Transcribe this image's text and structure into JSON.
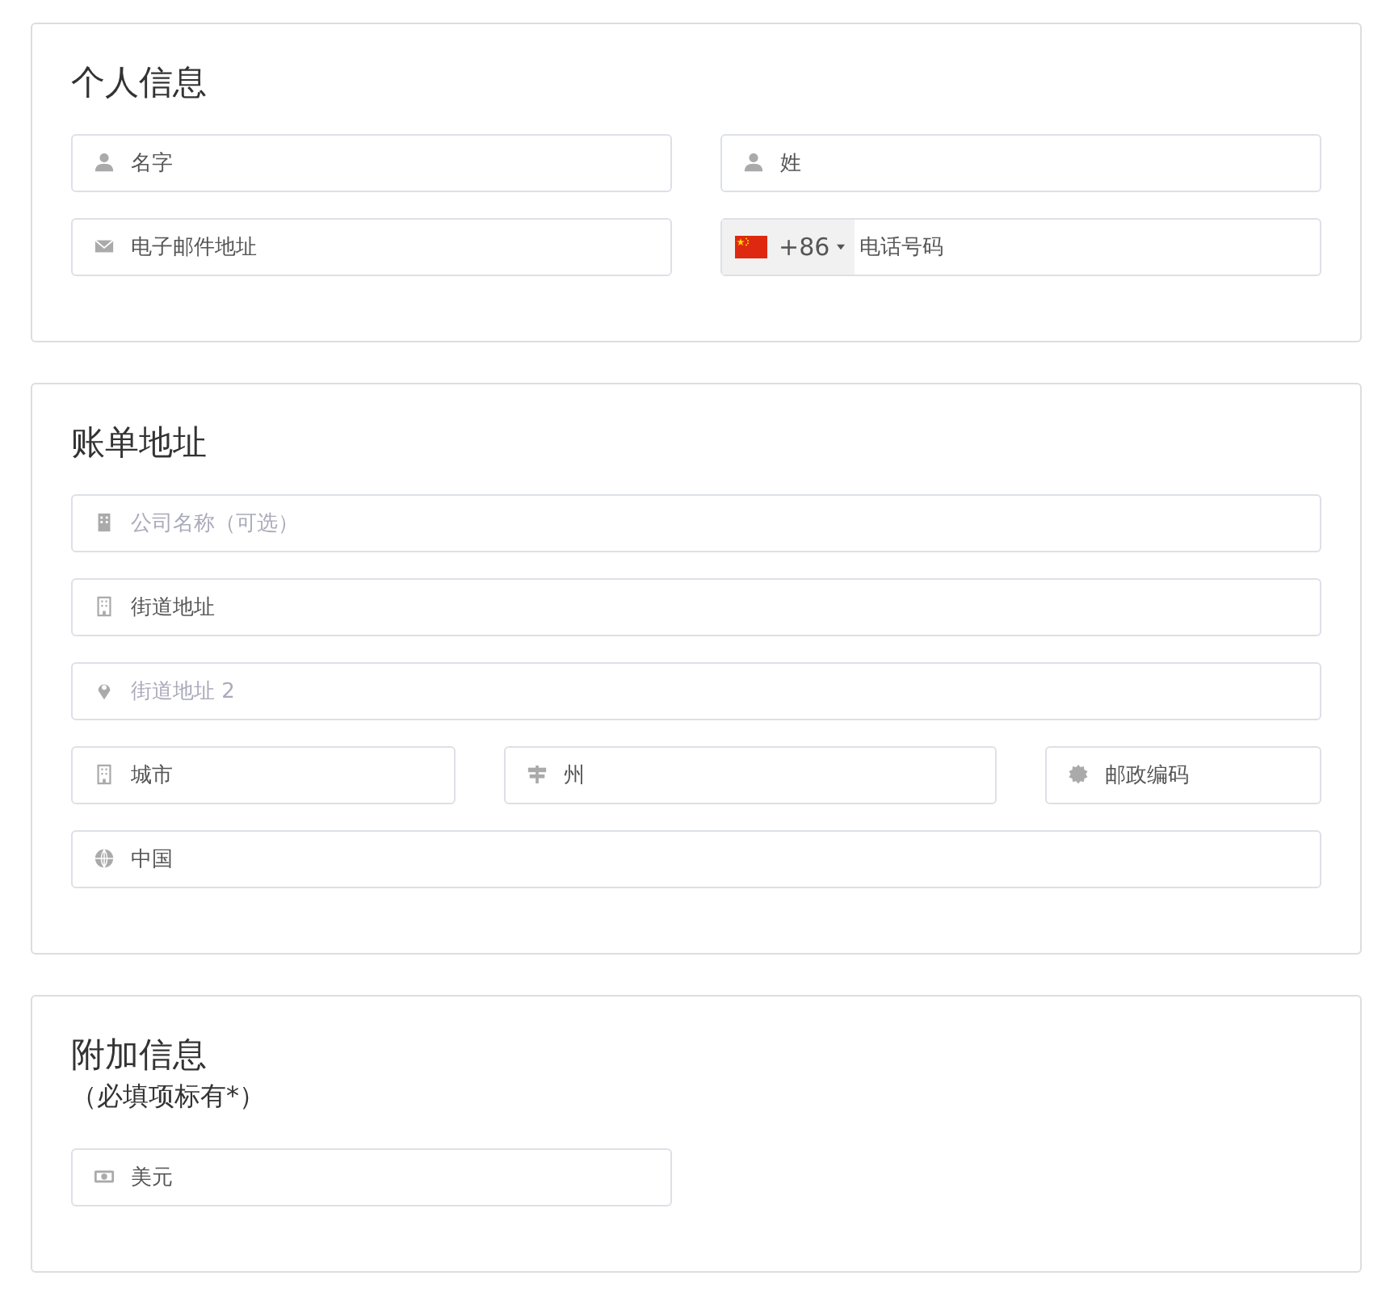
{
  "sections": [
    {
      "title": "个人信息",
      "rows": [
        [
          {
            "value": "名字"
          },
          {
            "value": "姓"
          }
        ],
        [
          {
            "value": "电子邮件地址"
          },
          {
            "kind": "phone",
            "dial_code": "+86",
            "value": "电话号码"
          }
        ]
      ]
    },
    {
      "title": "账单地址",
      "rows": [
        [
          {
            "placeholder": "公司名称（可选）"
          }
        ],
        [
          {
            "value": "街道地址"
          }
        ],
        [
          {
            "placeholder": "街道地址 2"
          }
        ],
        [
          {
            "value": "城市"
          },
          {
            "value": "州"
          },
          {
            "value": "邮政编码"
          }
        ],
        [
          {
            "value": "中国"
          }
        ]
      ]
    },
    {
      "title": "附加信息",
      "subtitle": "（必填项标有*）",
      "rows": [
        [
          {
            "value": "美元",
            "half": true
          }
        ]
      ]
    }
  ]
}
